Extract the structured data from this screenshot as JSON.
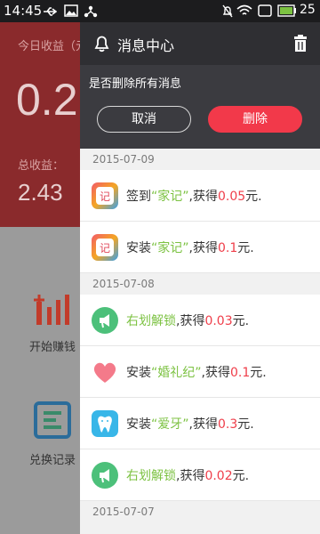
{
  "status_bar": {
    "time": "14:45",
    "battery": "25"
  },
  "background": {
    "today_label": "今日收益（元",
    "today_value": "0.2",
    "total_label": "总收益：",
    "total_value": "2.43",
    "items": [
      {
        "label": "开始赚钱"
      },
      {
        "label": "兑换记录"
      }
    ]
  },
  "drawer": {
    "title": "消息中心",
    "confirm": {
      "question": "是否删除所有消息",
      "cancel": "取消",
      "delete": "删除"
    },
    "sections": [
      {
        "date": "2015-07-09",
        "messages": [
          {
            "icon": "jiaji-app-icon",
            "action": "签到",
            "target": "“家记”",
            "mid": ",获得",
            "amount": "0.05",
            "unit": "元."
          },
          {
            "icon": "jiaji-app-icon",
            "action": "安装",
            "target": "“家记”",
            "mid": ",获得",
            "amount": "0.1",
            "unit": "元."
          }
        ]
      },
      {
        "date": "2015-07-08",
        "messages": [
          {
            "icon": "unlock-icon",
            "action": "",
            "target": "右划解锁",
            "mid": ",获得",
            "amount": "0.03",
            "unit": "元."
          },
          {
            "icon": "heart-icon",
            "action": "安装",
            "target": "“婚礼纪”",
            "mid": ",获得",
            "amount": "0.1",
            "unit": "元."
          },
          {
            "icon": "tooth-icon",
            "action": "安装",
            "target": "“爱牙”",
            "mid": ",获得",
            "amount": "0.3",
            "unit": "元."
          },
          {
            "icon": "unlock-icon",
            "action": "",
            "target": "右划解锁",
            "mid": ",获得",
            "amount": "0.02",
            "unit": "元."
          }
        ]
      },
      {
        "date": "2015-07-07",
        "messages": []
      }
    ],
    "colors": {
      "accent_green": "#7cc242",
      "accent_red": "#ef3e4a",
      "delete_button": "#f2394a"
    }
  }
}
